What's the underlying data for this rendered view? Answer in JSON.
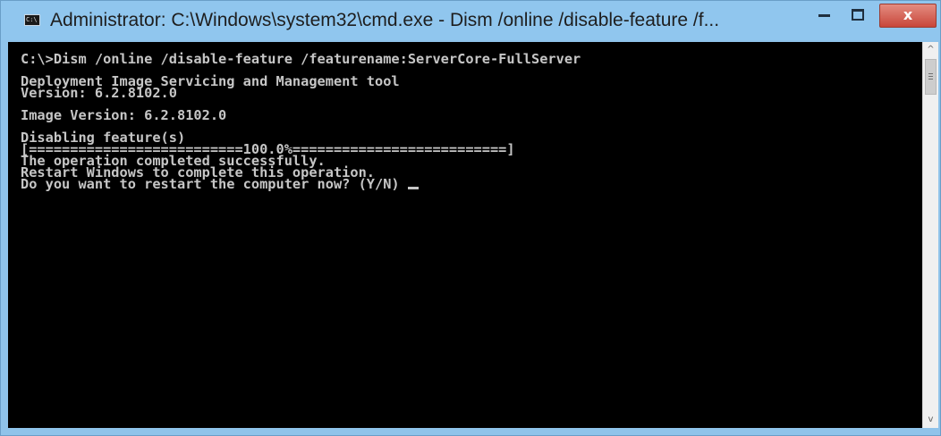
{
  "window": {
    "title": "Administrator: C:\\Windows\\system32\\cmd.exe - Dism  /online /disable-feature /f...",
    "app_icon_label": "C:\\",
    "controls": {
      "minimize_icon": "minimize-icon",
      "maximize_icon": "maximize-icon",
      "close_label": "x"
    }
  },
  "console": {
    "command": "C:\\>Dism /online /disable-feature /featurename:ServerCore-FullServer",
    "tool_name": "Deployment Image Servicing and Management tool",
    "tool_version": "Version: 6.2.8102.0",
    "image_version": "Image Version: 6.2.8102.0",
    "status": "Disabling feature(s)",
    "progress_bar": "[==========================100.0%==========================]",
    "progress_percent": 100.0,
    "result": "The operation completed successfully.",
    "restart_notice": "Restart Windows to complete this operation.",
    "prompt": "Do you want to restart the computer now? (Y/N)"
  },
  "scrollbar": {
    "up_arrow": "^",
    "down_arrow": "v"
  },
  "colors": {
    "titlebar": "#90c6ee",
    "console_background": "#000000",
    "console_text": "#c6c6c6",
    "close_button": "#c8463a"
  }
}
